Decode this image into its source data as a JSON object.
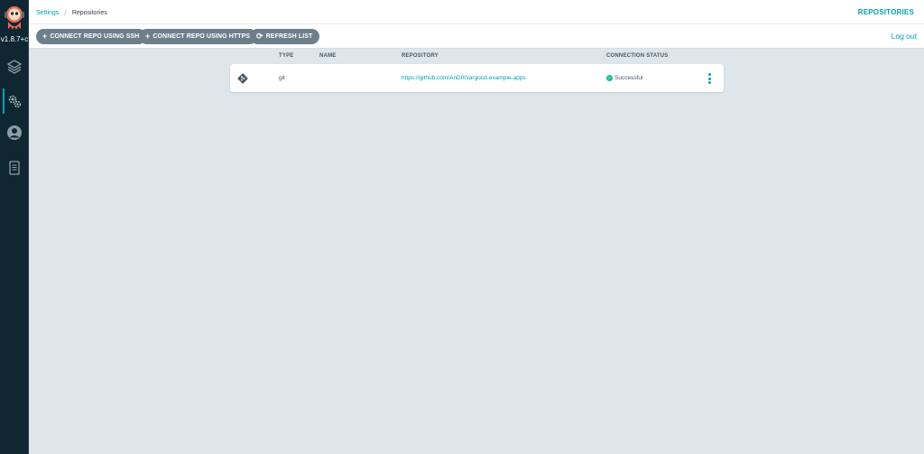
{
  "app": {
    "version": "v1.8.7+c"
  },
  "sidebar": {
    "items": [
      {
        "id": "applications",
        "icon": "layers-icon"
      },
      {
        "id": "settings",
        "icon": "gears-icon",
        "active": true
      },
      {
        "id": "user-info",
        "icon": "user-circle-icon"
      },
      {
        "id": "documentation",
        "icon": "book-icon"
      }
    ]
  },
  "breadcrumb": {
    "parent": "Settings",
    "current": "Repositories"
  },
  "header": {
    "title": "REPOSITORIES"
  },
  "toolbar": {
    "connect_ssh": "CONNECT REPO USING SSH",
    "connect_https": "CONNECT REPO USING HTTPS",
    "refresh": "REFRESH LIST",
    "logout": "Log out"
  },
  "table": {
    "columns": {
      "type": "TYPE",
      "name": "NAME",
      "repository": "REPOSITORY",
      "status": "CONNECTION STATUS"
    },
    "rows": [
      {
        "icon": "git-icon",
        "type": "git",
        "name": "",
        "repository": "https://github.com/AnD00/argocd-example-apps",
        "status": "Successful"
      }
    ]
  },
  "colors": {
    "accent": "#00a2b3",
    "sidebar": "#0f2733",
    "button": "#6d7f8b",
    "success": "#18be94",
    "background": "#dee6eb"
  }
}
